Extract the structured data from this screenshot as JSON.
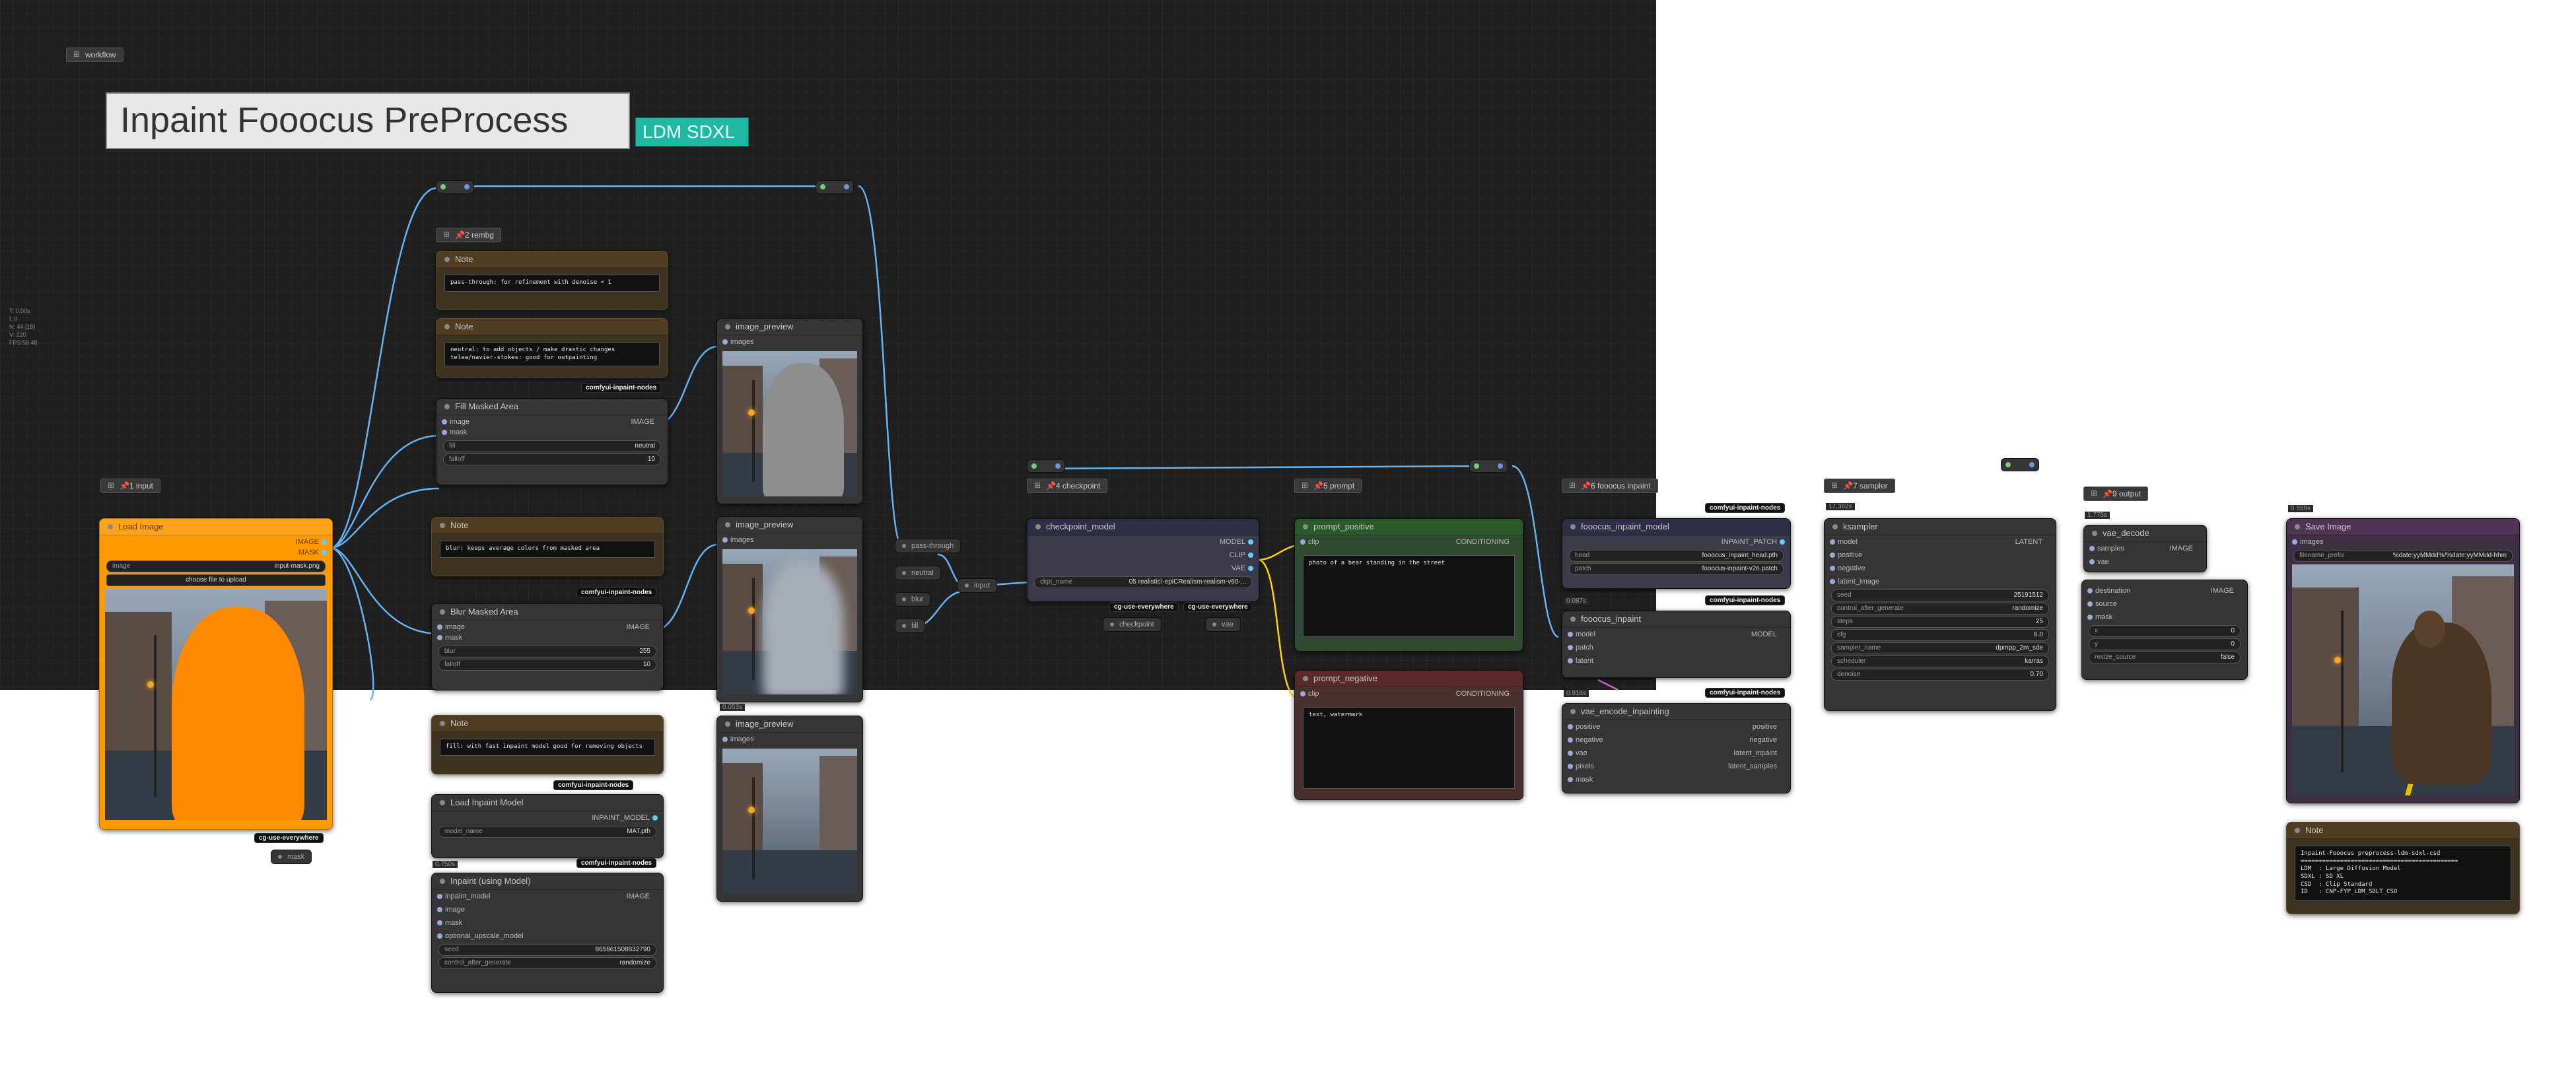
{
  "title": {
    "main": "Inpaint Fooocus PreProcess",
    "tag": "LDM SDXL"
  },
  "group": {
    "workflow": "workflow"
  },
  "stats": [
    "T: 0.00s",
    "I: 0",
    "N: 44 [15]",
    "V: 220",
    "FPS:58.48"
  ],
  "colors": {
    "background": "#1f1f1f",
    "link": "#64b5f6",
    "link_clip": "#ffd500",
    "accent": "#1fb8a2",
    "orange": "#ff9a00"
  },
  "groups": {
    "input": "📌1 input",
    "rembg": "📌2 rembg",
    "checkpoint": "📌4 checkpoint",
    "prompt": "📌5 prompt",
    "fooocus": "📌6 fooocus inpaint",
    "sampler": "📌7 sampler",
    "output": "📌9 output"
  },
  "load_image": {
    "title": "Load Image",
    "out_image": "IMAGE",
    "out_mask": "MASK",
    "image_label": "image",
    "image_value": "input-mask.png",
    "upload": "choose file to upload"
  },
  "notes": {
    "n1_title": "Note",
    "n1_text": "pass-through: for refinement with denoise < 1",
    "n2_title": "Note",
    "n2_text": "neutral: to add objects / make drastic changes\ntelea/navier-stokes: good for outpainting",
    "n3_title": "Note",
    "n3_text": "blur: keeps average colors from masked area",
    "n4_title": "Note",
    "n4_text": "fill: with fast inpaint model good for removing objects",
    "n5_title": "Note",
    "n5_text": "Inpaint-Fooocus preprocess-ldm-sdxl-csd\n============================================\nLDM  : Large Diffusion Model\nSDXL : SD XL\nCSD  : Clip Standard\nID   : CNP-FYP_LDM_SDLT_CSO"
  },
  "fill_masked": {
    "title": "Fill Masked Area",
    "image": "image",
    "mask": "mask",
    "out": "IMAGE",
    "fill_label": "fill",
    "fill_value": "neutral",
    "falloff_label": "falloff",
    "falloff_value": "10"
  },
  "blur_masked": {
    "title": "Blur Masked Area",
    "image": "image",
    "mask": "mask",
    "out": "IMAGE",
    "blur_label": "blur",
    "blur_value": "255",
    "falloff_label": "falloff",
    "falloff_value": "10"
  },
  "load_inpaint": {
    "title": "Load Inpaint Model",
    "out": "INPAINT_MODEL",
    "model_label": "model_name",
    "model_value": "MAT.pth"
  },
  "inpaint_model": {
    "title": "Inpaint (using Model)",
    "in1": "inpaint_model",
    "in2": "image",
    "in3": "mask",
    "in4": "optional_upscale_model",
    "out": "IMAGE",
    "seed_label": "seed",
    "seed_value": "865861508832790",
    "caf_label": "control_after_generate",
    "caf_value": "randomize"
  },
  "badges": {
    "cui_inpaint": "comfyui-inpaint-nodes",
    "cg_use": "cg-use-everywhere"
  },
  "timers": {
    "t1": "0.750s",
    "t2": "0.053s",
    "t3": "0.087s",
    "t4": "0.816s",
    "t5": "17.382s",
    "t6": "1.775s",
    "t7": "0.559s"
  },
  "previews": {
    "title": "image_preview",
    "images": "images"
  },
  "switch_inputs": [
    "pass-through",
    "neutral",
    "blur",
    "fill"
  ],
  "switch_out": "input",
  "mask_reroute": "mask",
  "checkpoint": {
    "title": "checkpoint_model",
    "out_model": "MODEL",
    "out_clip": "CLIP",
    "out_vae": "VAE",
    "ckpt_label": "ckpt_name",
    "ckpt_value": "05 realistic\\-epiCRealism-realism-v60-...",
    "tiny1": "checkpoint",
    "tiny2": "vae"
  },
  "prompt_pos": {
    "title": "prompt_positive",
    "clip": "clip",
    "out": "CONDITIONING",
    "text": "photo of a bear standing in the street"
  },
  "prompt_neg": {
    "title": "prompt_negative",
    "clip": "clip",
    "out": "CONDITIONING",
    "text": "text, watermark"
  },
  "fooocus_model": {
    "title": "fooocus_inpaint_model",
    "out": "INPAINT_PATCH",
    "head_label": "head",
    "head_value": "fooocus_inpaint_head.pth",
    "patch_label": "patch",
    "patch_value": "fooocus-inpaint-v26.patch"
  },
  "fooocus_inpaint": {
    "title": "fooocus_inpaint",
    "in1": "model",
    "in2": "patch",
    "in3": "latent",
    "out": "MODEL"
  },
  "vae_encode": {
    "title": "vae_encode_inpainting",
    "in": [
      "positive",
      "negative",
      "vae",
      "pixels",
      "mask"
    ],
    "out": [
      "positive",
      "negative",
      "latent_inpaint",
      "latent_samples"
    ]
  },
  "ksampler": {
    "title": "ksampler",
    "in": [
      "model",
      "positive",
      "negative",
      "latent_image"
    ],
    "out": "LATENT",
    "widgets": [
      {
        "label": "seed",
        "value": "25191512"
      },
      {
        "label": "control_after_generate",
        "value": "randomize"
      },
      {
        "label": "steps",
        "value": "25"
      },
      {
        "label": "cfg",
        "value": "6.0"
      },
      {
        "label": "sampler_name",
        "value": "dpmpp_2m_sde"
      },
      {
        "label": "scheduler",
        "value": "karras"
      },
      {
        "label": "denoise",
        "value": "0.70"
      }
    ]
  },
  "vae_decode": {
    "title": "vae_decode",
    "in1": "samples",
    "in2": "vae",
    "out": "IMAGE"
  },
  "image_composite": {
    "in": [
      "destination",
      "source",
      "mask"
    ],
    "out": "IMAGE",
    "x_label": "x",
    "x_value": "0",
    "y_label": "y",
    "y_value": "0",
    "resize_label": "resize_source",
    "resize_value": "false"
  },
  "save_image": {
    "title": "Save Image",
    "images": "images",
    "prefix_label": "filename_prefix",
    "prefix_value": "%date:yyMMdd%/%date:yyMMdd-hhm"
  }
}
